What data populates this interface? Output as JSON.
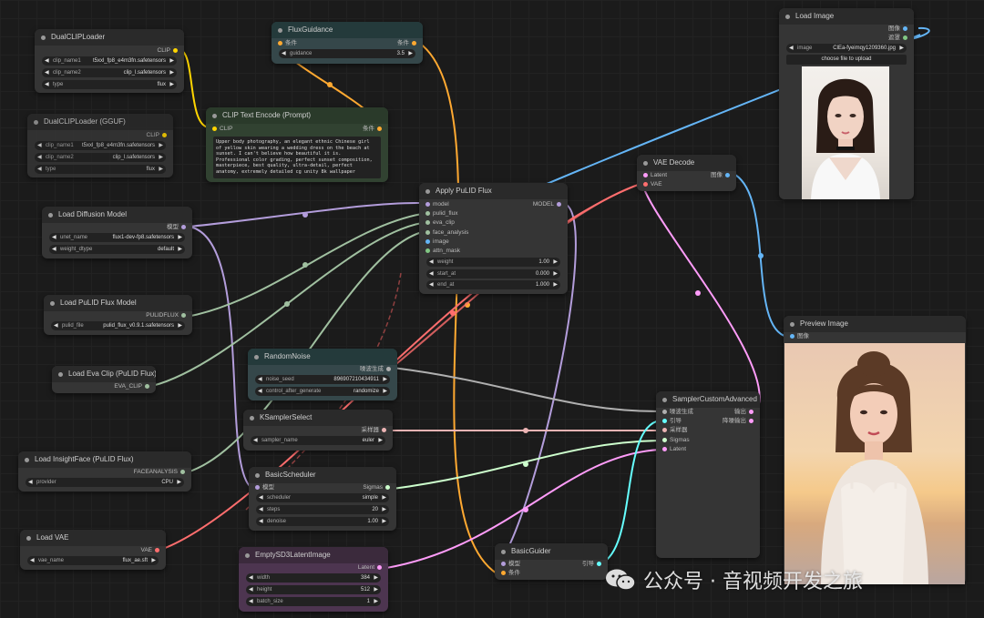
{
  "nodes": {
    "dualclip": {
      "title": "DualCLIPLoader",
      "out": "CLIP",
      "w": [
        {
          "l": "clip_name1",
          "v": "t5xxl_fp8_e4m3fn.safetensors"
        },
        {
          "l": "clip_name2",
          "v": "clip_l.safetensors"
        },
        {
          "l": "type",
          "v": "flux"
        }
      ]
    },
    "dualclip_gguf": {
      "title": "DualCLIPLoader (GGUF)",
      "out": "CLIP",
      "w": [
        {
          "l": "clip_name1",
          "v": "t5xxl_fp8_e4m3fn.safetensors"
        },
        {
          "l": "clip_name2",
          "v": "clip_l.safetensors"
        },
        {
          "l": "type",
          "v": "flux"
        }
      ]
    },
    "fluxguidance": {
      "title": "FluxGuidance",
      "in": "条件",
      "out": "条件",
      "w": [
        {
          "l": "guidance",
          "v": "3.5"
        }
      ]
    },
    "cliptext": {
      "title": "CLIP Text Encode (Prompt)",
      "in": "CLIP",
      "out": "条件",
      "text": "Upper body photography, an elegant ethnic Chinese girl of yellow skin wearing a wedding dress on the beach at sunset. I can't believe how beautiful it is. Professional color grading, perfect sunset composition, masterpiece, best quality, ultra-detail, perfect anatomy, extremely detailed cg unity 8k wallpaper"
    },
    "loaddiff": {
      "title": "Load Diffusion Model",
      "out": "模型",
      "w": [
        {
          "l": "unet_name",
          "v": "flux1-dev-fp8.safetensors"
        },
        {
          "l": "weight_dtype",
          "v": "default"
        }
      ]
    },
    "pulid_model": {
      "title": "Load PuLID Flux Model",
      "out": "PULIDFLUX",
      "w": [
        {
          "l": "pulid_file",
          "v": "pulid_flux_v0.9.1.safetensors"
        }
      ]
    },
    "evaclip": {
      "title": "Load Eva Clip (PuLID Flux)",
      "out": "EVA_CLIP"
    },
    "insightface": {
      "title": "Load InsightFace (PuLID Flux)",
      "out": "FACEANALYSIS",
      "w": [
        {
          "l": "provider",
          "v": "CPU"
        }
      ]
    },
    "loadvae": {
      "title": "Load VAE",
      "out": "VAE",
      "w": [
        {
          "l": "vae_name",
          "v": "flux_ae.sft"
        }
      ]
    },
    "applypulid": {
      "title": "Apply PuLID Flux",
      "ins": [
        "model",
        "pulid_flux",
        "eva_clip",
        "face_analysis",
        "image",
        "attn_mask"
      ],
      "out": "MODEL",
      "w": [
        {
          "l": "weight",
          "v": "1.00"
        },
        {
          "l": "start_at",
          "v": "0.000"
        },
        {
          "l": "end_at",
          "v": "1.000"
        }
      ]
    },
    "randomnoise": {
      "title": "RandomNoise",
      "out": "噪波生成",
      "w": [
        {
          "l": "noise_seed",
          "v": "896907210434911"
        },
        {
          "l": "control_after_generate",
          "v": "randomize"
        }
      ]
    },
    "ksampler": {
      "title": "KSamplerSelect",
      "out": "采样器",
      "w": [
        {
          "l": "sampler_name",
          "v": "euler"
        }
      ]
    },
    "basicsched": {
      "title": "BasicScheduler",
      "in": "模型",
      "out": "Sigmas",
      "w": [
        {
          "l": "scheduler",
          "v": "simple"
        },
        {
          "l": "steps",
          "v": "20"
        },
        {
          "l": "denoise",
          "v": "1.00"
        }
      ]
    },
    "emptylatent": {
      "title": "EmptySD3LatentImage",
      "out": "Latent",
      "w": [
        {
          "l": "width",
          "v": "384"
        },
        {
          "l": "height",
          "v": "512"
        },
        {
          "l": "batch_size",
          "v": "1"
        }
      ]
    },
    "basicguider": {
      "title": "BasicGuider",
      "ins": [
        "模型",
        "条件"
      ],
      "out": "引导"
    },
    "samplercustom": {
      "title": "SamplerCustomAdvanced",
      "ins": [
        "噪波生成",
        "引导",
        "采样器",
        "Sigmas",
        "Latent"
      ],
      "outs": [
        "输出",
        "降噪输出"
      ]
    },
    "vaedecode": {
      "title": "VAE Decode",
      "ins": [
        "Latent",
        "VAE"
      ],
      "out": "图像"
    },
    "loadimage": {
      "title": "Load Image",
      "outs": [
        "图像",
        "遮罩"
      ],
      "w": [
        {
          "l": "image",
          "v": "ClEa-fyeimqy1209360.jpg"
        }
      ],
      "button": "choose file to upload"
    },
    "preview": {
      "title": "Preview Image",
      "in": "图像"
    }
  },
  "watermark": "公众号 · 音视频开发之旅",
  "colors": {
    "clip": "#ffd500",
    "cond": "#ffa931",
    "model": "#b39ddb",
    "vae": "#ff6e6e",
    "image": "#64b5f6",
    "latent": "#ff9cf9",
    "sigmas": "#cdffcd",
    "noise": "#b0b0b0",
    "sampler": "#ecb4b4",
    "guider": "#66ffff",
    "pulid": "#a0c0a0"
  }
}
